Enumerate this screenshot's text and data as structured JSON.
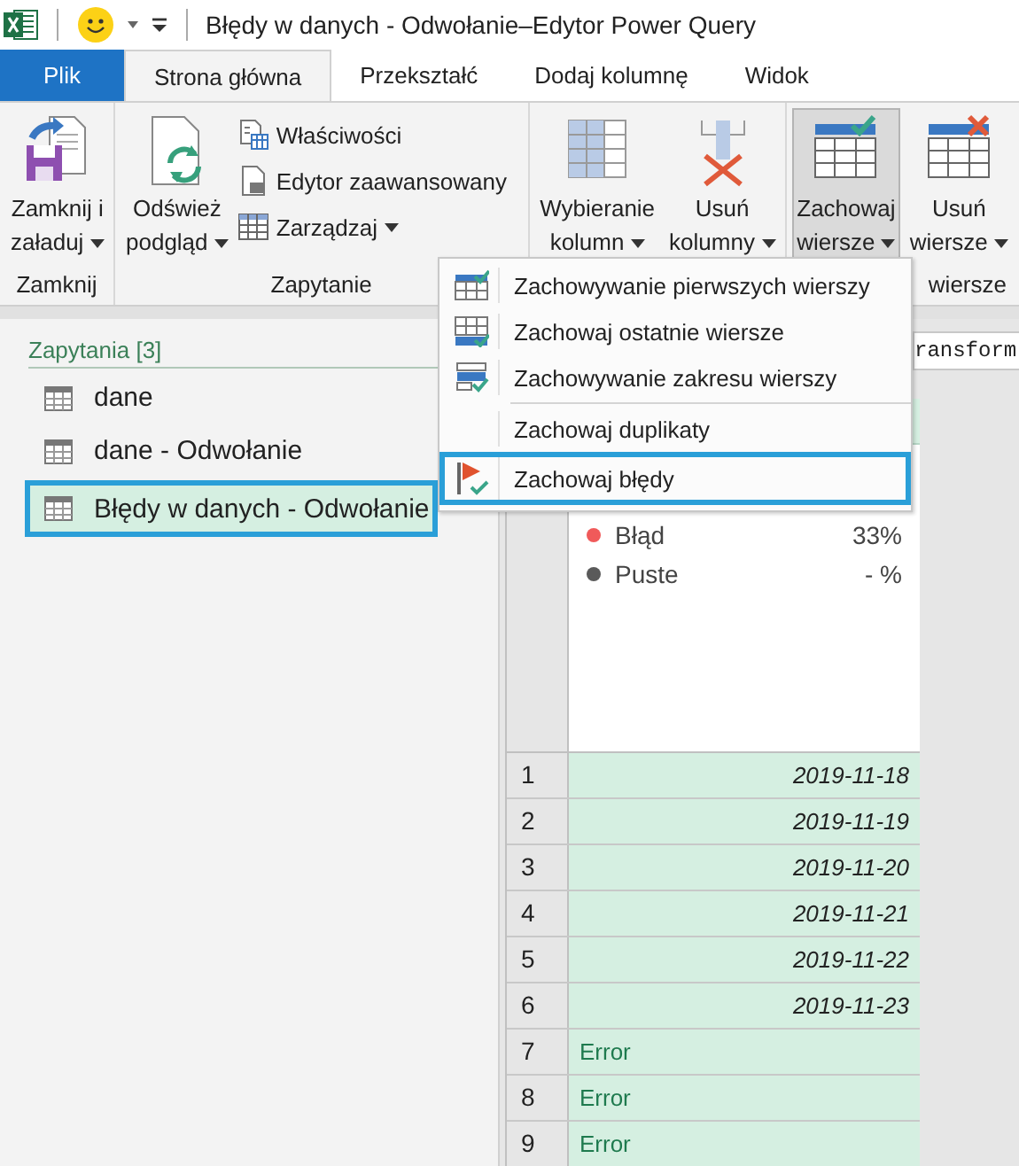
{
  "title_bar": {
    "title": "Błędy w danych - Odwołanie–Edytor Power Query"
  },
  "tabs": [
    {
      "label": "Plik",
      "kind": "file",
      "selected": false
    },
    {
      "label": "Strona główna",
      "kind": "tab",
      "selected": true
    },
    {
      "label": "Przekształć",
      "kind": "tab",
      "selected": false
    },
    {
      "label": "Dodaj kolumnę",
      "kind": "tab",
      "selected": false
    },
    {
      "label": "Widok",
      "kind": "tab",
      "selected": false
    }
  ],
  "ribbon": {
    "groups": [
      {
        "label": "Zamknij",
        "buttons": [
          {
            "lines": [
              "Zamknij i",
              "załaduj"
            ],
            "pressed": false
          }
        ]
      },
      {
        "label": "Zapytanie",
        "buttons": [
          {
            "lines": [
              "Odśwież",
              "podgląd"
            ],
            "pressed": false
          }
        ],
        "small": [
          {
            "label": "Właściwości",
            "dropdown": false
          },
          {
            "label": "Edytor zaawansowany",
            "dropdown": false
          },
          {
            "label": "Zarządzaj",
            "dropdown": true
          }
        ]
      },
      {
        "buttons": [
          {
            "lines": [
              "Wybieranie",
              "kolumn"
            ],
            "pressed": false
          },
          {
            "lines": [
              "Usuń",
              "kolumny"
            ],
            "pressed": false
          }
        ]
      },
      {
        "label": "wiersze",
        "buttons": [
          {
            "lines": [
              "Zachowaj",
              "wiersze"
            ],
            "pressed": true
          },
          {
            "lines": [
              "Usuń",
              "wiersze"
            ],
            "pressed": false
          }
        ]
      }
    ]
  },
  "menu": {
    "items": [
      {
        "label": "Zachowywanie pierwszych wierszy",
        "selected": false
      },
      {
        "label": "Zachowaj ostatnie wiersze",
        "selected": false
      },
      {
        "label": "Zachowywanie zakresu wierszy",
        "selected": false
      },
      {
        "label": "Zachowaj duplikaty",
        "selected": false
      },
      {
        "label": "Zachowaj błędy",
        "selected": true
      }
    ]
  },
  "queries": {
    "header": "Zapytania [3]",
    "items": [
      {
        "label": "dane",
        "selected": false
      },
      {
        "label": "dane - Odwołanie",
        "selected": false
      },
      {
        "label": "Błędy w danych - Odwołanie",
        "selected": true
      }
    ]
  },
  "formula_bar": {
    "text": "ransform"
  },
  "profile": [
    {
      "label": "Błąd",
      "value": "33%",
      "color": "#f05a5a"
    },
    {
      "label": "Puste",
      "value": "- %",
      "color": "#5a5a5a"
    }
  ],
  "rows": [
    {
      "num": "1",
      "value": "2019-11-18",
      "kind": "date"
    },
    {
      "num": "2",
      "value": "2019-11-19",
      "kind": "date"
    },
    {
      "num": "3",
      "value": "2019-11-20",
      "kind": "date"
    },
    {
      "num": "4",
      "value": "2019-11-21",
      "kind": "date"
    },
    {
      "num": "5",
      "value": "2019-11-22",
      "kind": "date"
    },
    {
      "num": "6",
      "value": "2019-11-23",
      "kind": "date"
    },
    {
      "num": "7",
      "value": "Error",
      "kind": "error"
    },
    {
      "num": "8",
      "value": "Error",
      "kind": "error"
    },
    {
      "num": "9",
      "value": "Error",
      "kind": "error"
    }
  ]
}
